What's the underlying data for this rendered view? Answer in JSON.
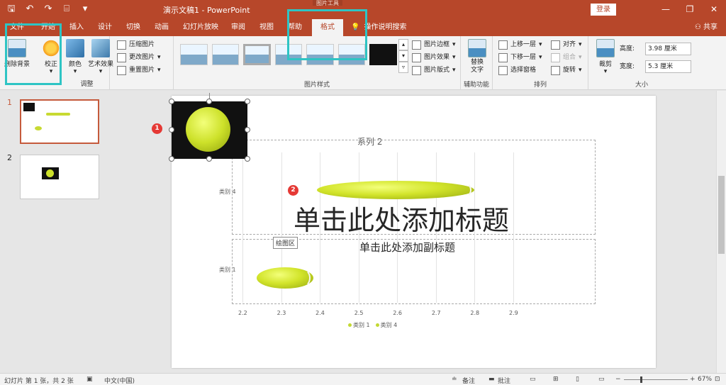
{
  "window": {
    "title": "演示文稿1  -  PowerPoint",
    "context_tab_group": "图片工具",
    "login_label": "登录",
    "min": "—",
    "restore": "❐",
    "close": "✕"
  },
  "qat": {
    "save": "🖫",
    "undo": "↶",
    "redo": "↷",
    "present": "⌸",
    "more": "▾"
  },
  "tabs": [
    "文件",
    "开始",
    "插入",
    "设计",
    "切换",
    "动画",
    "幻灯片放映",
    "审阅",
    "视图",
    "帮助",
    "格式"
  ],
  "active_tab": "格式",
  "search_label": "操作说明搜索",
  "share_label": "共享",
  "ribbon": {
    "adjust": {
      "remove_bg": "删除背景",
      "corrections": "校正",
      "color": "颜色",
      "artistic": "艺术效果",
      "compress": "压缩图片",
      "change": "更改图片",
      "reset": "重置图片",
      "label": "调整"
    },
    "styles": {
      "border": "图片边框",
      "effects": "图片效果",
      "layout": "图片版式",
      "label": "图片样式"
    },
    "accessibility": {
      "alt_text": "替换\n文字",
      "label": "辅助功能"
    },
    "arrange": {
      "bring_forward": "上移一层",
      "send_backward": "下移一层",
      "selection_pane": "选择窗格",
      "align": "对齐",
      "group": "组合",
      "rotate": "旋转",
      "label": "排列"
    },
    "size": {
      "crop": "裁剪",
      "height_label": "高度:",
      "height_value": "3.98 厘米",
      "width_label": "宽度:",
      "width_value": "5.3 厘米",
      "label": "大小"
    }
  },
  "slides": [
    {
      "num": "1"
    },
    {
      "num": "2"
    }
  ],
  "slide": {
    "title_placeholder": "单击此处添加标题",
    "subtitle_placeholder": "单击此处添加副标题",
    "tooltip": "绘图区",
    "badge1": "1",
    "badge2": "2"
  },
  "chart_data": {
    "type": "bar",
    "orientation": "horizontal",
    "title": "系列 2",
    "categories": [
      "类别 1",
      "类别 4"
    ],
    "series": [
      {
        "name": "类别 1",
        "values": [
          2.45
        ]
      },
      {
        "name": "类别 4",
        "values": [
          2.8
        ]
      }
    ],
    "xlim": [
      2.2,
      2.9
    ],
    "xticks": [
      "2.2",
      "2.3",
      "2.4",
      "2.5",
      "2.6",
      "2.7",
      "2.8",
      "2.9"
    ],
    "legend": [
      "类别 1",
      "类别 4"
    ],
    "legend_position": "bottom",
    "grid": true
  },
  "status": {
    "slide_info": "幻灯片 第 1 张，共 2 张",
    "language": "中文(中国)",
    "notes": "备注",
    "comments": "批注",
    "zoom": "67%",
    "zoom_minus": "−",
    "zoom_plus": "+"
  }
}
